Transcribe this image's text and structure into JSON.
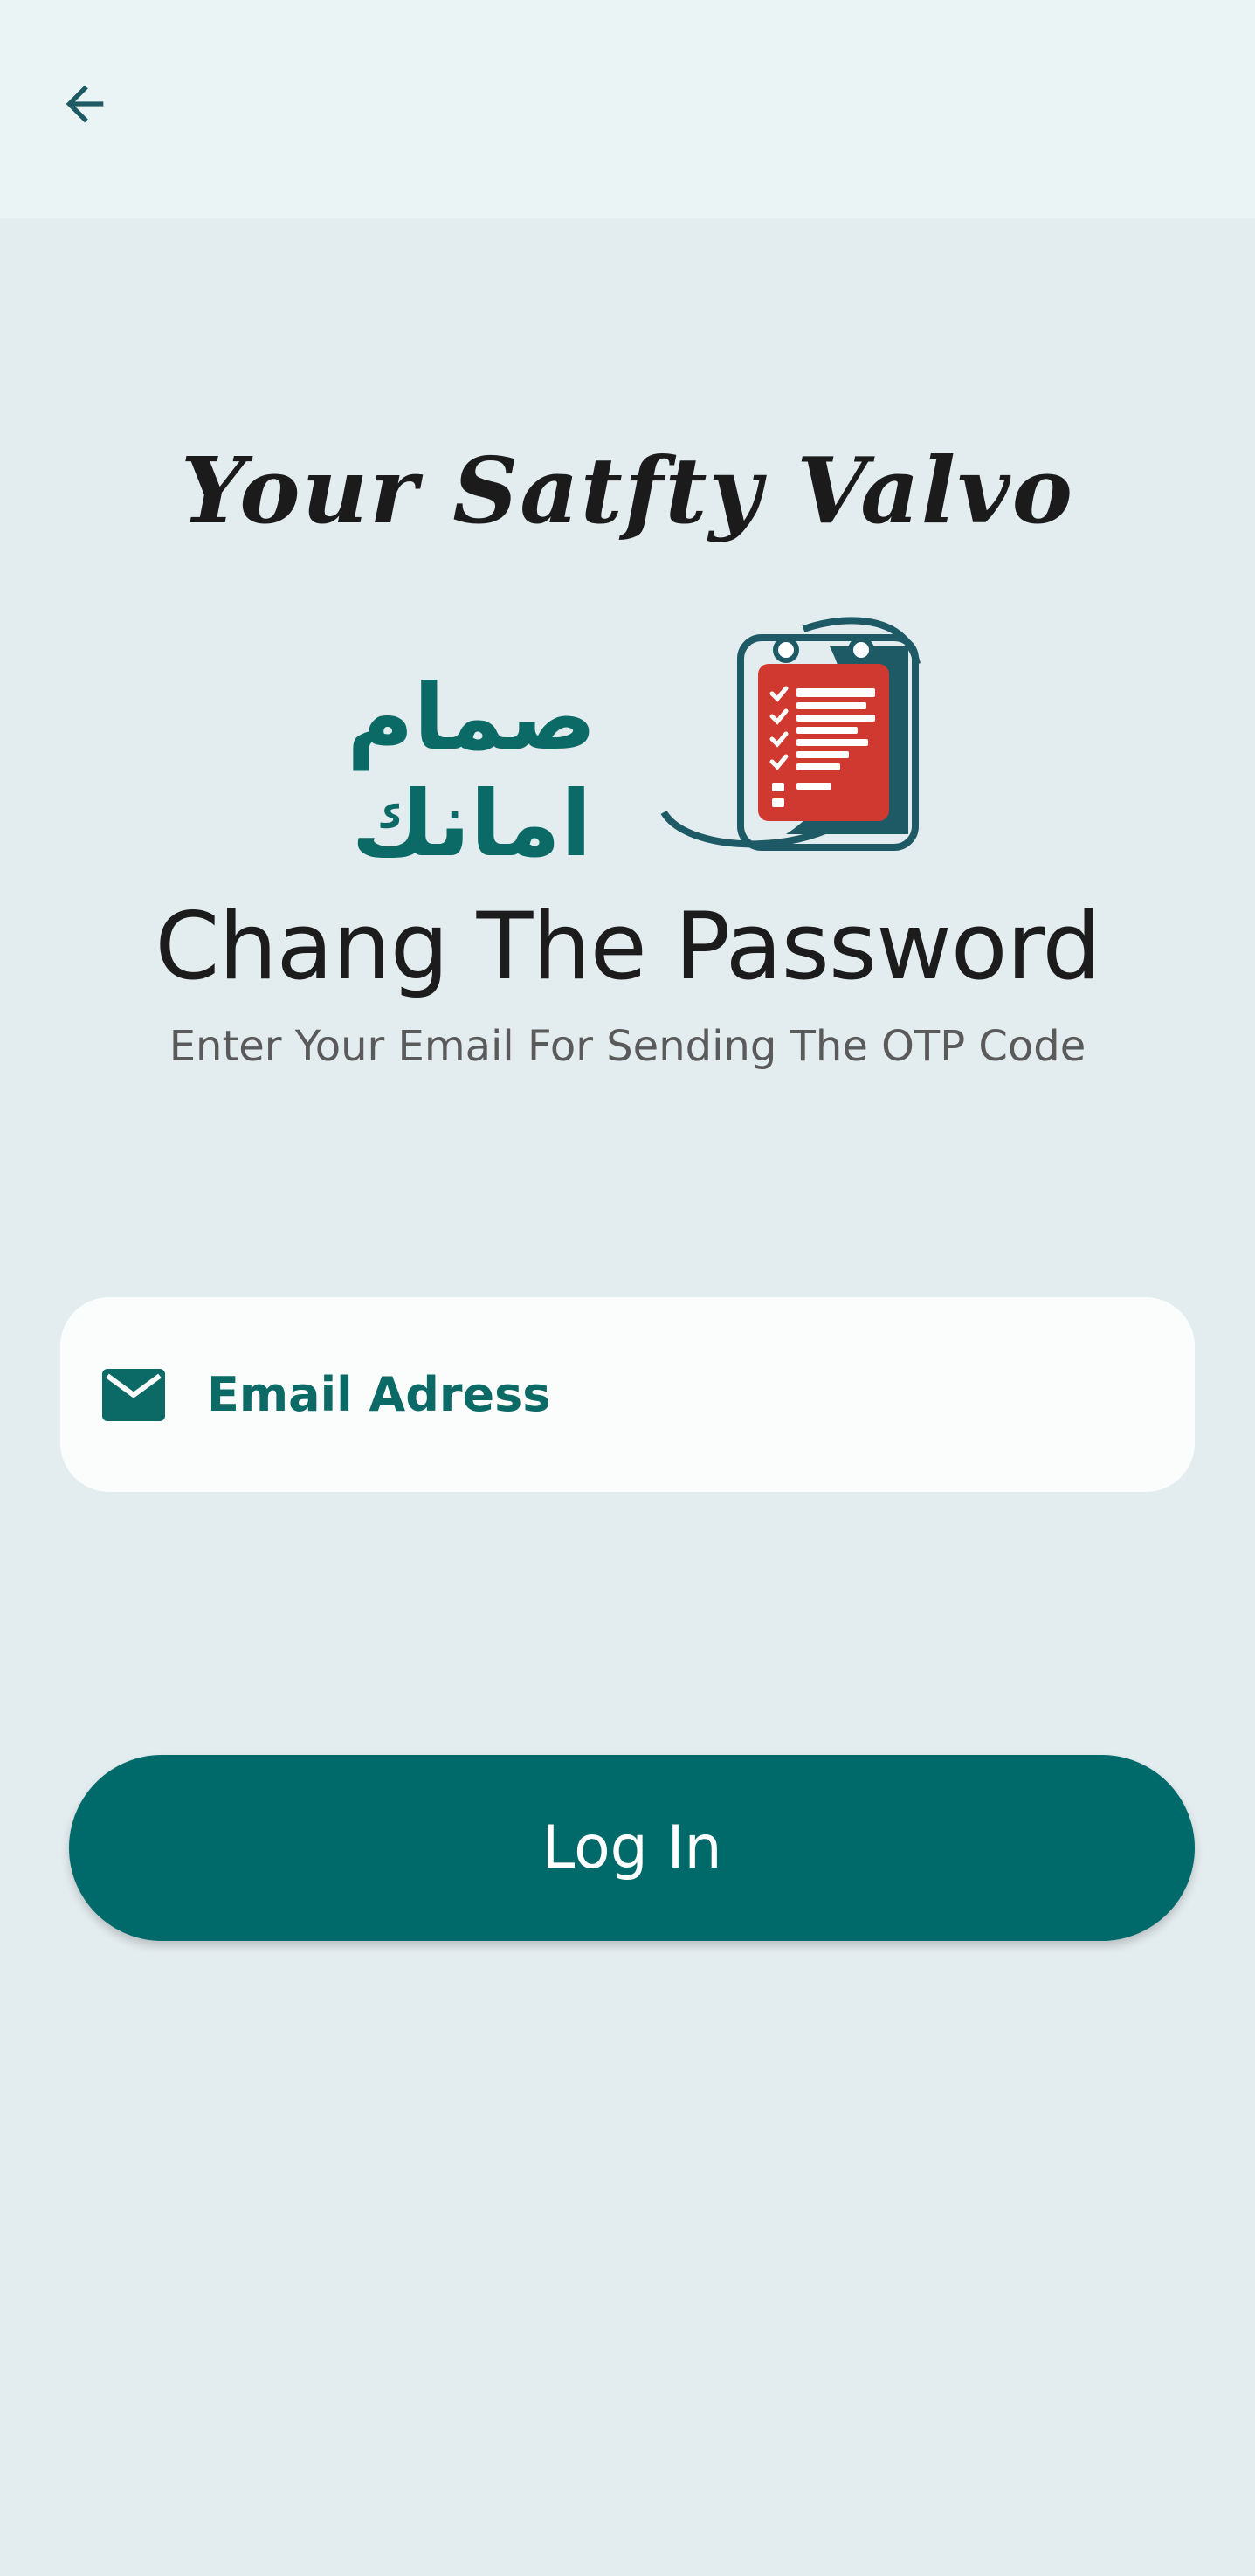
{
  "app_bar": {
    "back_icon": "arrow-left-icon"
  },
  "branding": {
    "tagline": "Your Satfty Valvo",
    "arabic_name": "صمام امانك",
    "logo_icon": "clipboard-checklist-icon"
  },
  "header": {
    "title": "Chang The Password",
    "subtitle": "Enter Your Email For Sending The OTP Code"
  },
  "form": {
    "email": {
      "icon": "envelope-icon",
      "placeholder": "Email Adress",
      "value": ""
    },
    "submit_label": "Log In"
  },
  "colors": {
    "primary": "#006a6a",
    "accent_text": "#0b6a66",
    "background": "#e3ecef",
    "app_bar": "#eaf4f4",
    "logo_red": "#d0392f",
    "logo_dark": "#1e5a66"
  }
}
